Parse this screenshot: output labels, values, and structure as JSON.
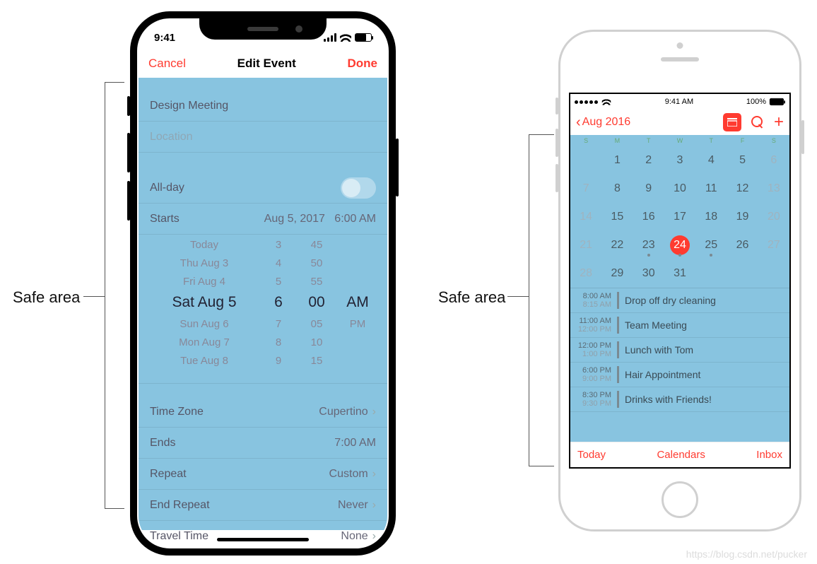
{
  "labels": {
    "safe_area": "Safe area"
  },
  "watermark": "https://blog.csdn.net/pucker",
  "phone_x": {
    "status": {
      "time": "9:41"
    },
    "nav": {
      "cancel": "Cancel",
      "title": "Edit Event",
      "done": "Done"
    },
    "form": {
      "title_value": "Design Meeting",
      "location_placeholder": "Location",
      "allday_label": "All-day",
      "starts_label": "Starts",
      "starts_date": "Aug 5, 2017",
      "starts_time": "6:00 AM",
      "timezone_label": "Time Zone",
      "timezone_value": "Cupertino",
      "ends_label": "Ends",
      "ends_value": "7:00 AM",
      "repeat_label": "Repeat",
      "repeat_value": "Custom",
      "endrepeat_label": "End Repeat",
      "endrepeat_value": "Never",
      "travel_label": "Travel Time",
      "travel_value": "None"
    },
    "picker": {
      "rows": [
        {
          "d": "Today",
          "h": "3",
          "m": "45",
          "p": ""
        },
        {
          "d": "Thu Aug 3",
          "h": "4",
          "m": "50",
          "p": ""
        },
        {
          "d": "Fri Aug 4",
          "h": "5",
          "m": "55",
          "p": ""
        },
        {
          "d": "Sat Aug 5",
          "h": "6",
          "m": "00",
          "p": "AM"
        },
        {
          "d": "Sun Aug 6",
          "h": "7",
          "m": "05",
          "p": "PM"
        },
        {
          "d": "Mon Aug 7",
          "h": "8",
          "m": "10",
          "p": ""
        },
        {
          "d": "Tue Aug 8",
          "h": "9",
          "m": "15",
          "p": ""
        }
      ],
      "selected_index": 3
    }
  },
  "phone_8": {
    "status": {
      "time": "9:41 AM",
      "battery": "100%"
    },
    "nav": {
      "back": "Aug 2016"
    },
    "calendar": {
      "dow": [
        "S",
        "M",
        "T",
        "W",
        "T",
        "F",
        "S"
      ],
      "days": [
        [
          "",
          "1",
          "2",
          "3",
          "4",
          "5",
          "6"
        ],
        [
          "7",
          "8",
          "9",
          "10",
          "11",
          "12",
          "13"
        ],
        [
          "14",
          "15",
          "16",
          "17",
          "18",
          "19",
          "20"
        ],
        [
          "21",
          "22",
          "23",
          "24",
          "25",
          "26",
          "27"
        ],
        [
          "28",
          "29",
          "30",
          "31",
          "",
          "",
          ""
        ]
      ],
      "weekend_cols": [
        0,
        6
      ],
      "event_dots": [
        "23",
        "24",
        "25"
      ],
      "selected": "24"
    },
    "events": [
      {
        "t1": "8:00 AM",
        "t2": "8:15 AM",
        "title": "Drop off dry cleaning"
      },
      {
        "t1": "11:00 AM",
        "t2": "12:00 PM",
        "title": "Team Meeting"
      },
      {
        "t1": "12:00 PM",
        "t2": "1:00 PM",
        "title": "Lunch with Tom"
      },
      {
        "t1": "6:00 PM",
        "t2": "9:00 PM",
        "title": "Hair Appointment"
      },
      {
        "t1": "8:30 PM",
        "t2": "9:30 PM",
        "title": "Drinks with Friends!"
      }
    ],
    "toolbar": {
      "today": "Today",
      "calendars": "Calendars",
      "inbox": "Inbox"
    }
  }
}
